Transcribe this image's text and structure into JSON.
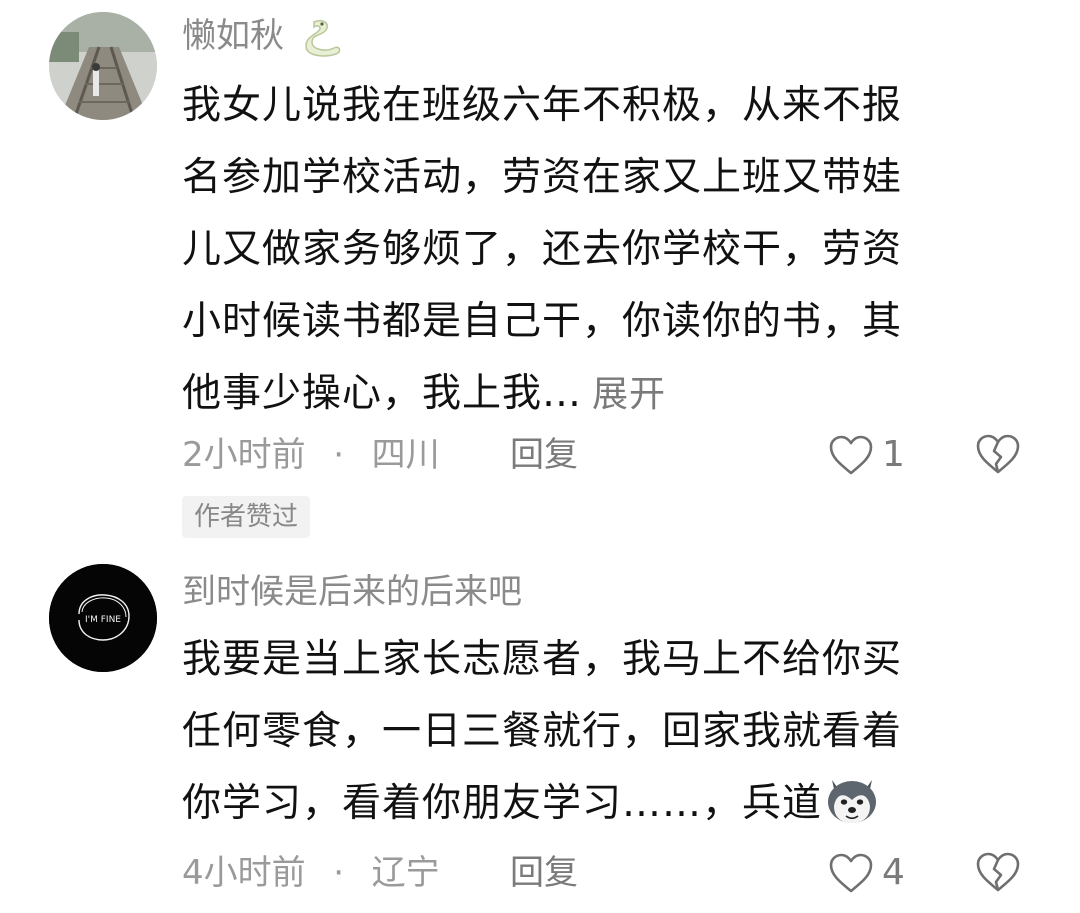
{
  "comments": [
    {
      "username": "懒如秋",
      "user_emoji": "snake-emoji-icon",
      "body_lines": [
        "我女儿说我在班级六年不积极，从来不报",
        "名参加学校活动，劳资在家又上班又带娃",
        "儿又做家务够烦了，还去你学校干，劳资",
        "小时候读书都是自己干，你读你的书，其",
        "他事少操心，我上我…"
      ],
      "expand_label": "展开",
      "time": "2小时前",
      "separator": "·",
      "location": "四川",
      "reply_label": "回复",
      "like_count": "1",
      "badge": "作者赞过"
    },
    {
      "username": "到时候是后来的后来吧",
      "avatar_text": "I'M FINE",
      "body_lines": [
        "我要是当上家长志愿者，我马上不给你买",
        "任何零食，一日三餐就行，回家我就看着",
        "你学习，看着你朋友学习……，兵道"
      ],
      "inline_emoji": "husky-dog-emoji-icon",
      "time": "4小时前",
      "separator": "·",
      "location": "辽宁",
      "reply_label": "回复",
      "like_count": "4"
    }
  ],
  "colors": {
    "text": "#111111",
    "secondary": "#8a8a8a",
    "badge_bg": "#f2f2f2"
  }
}
